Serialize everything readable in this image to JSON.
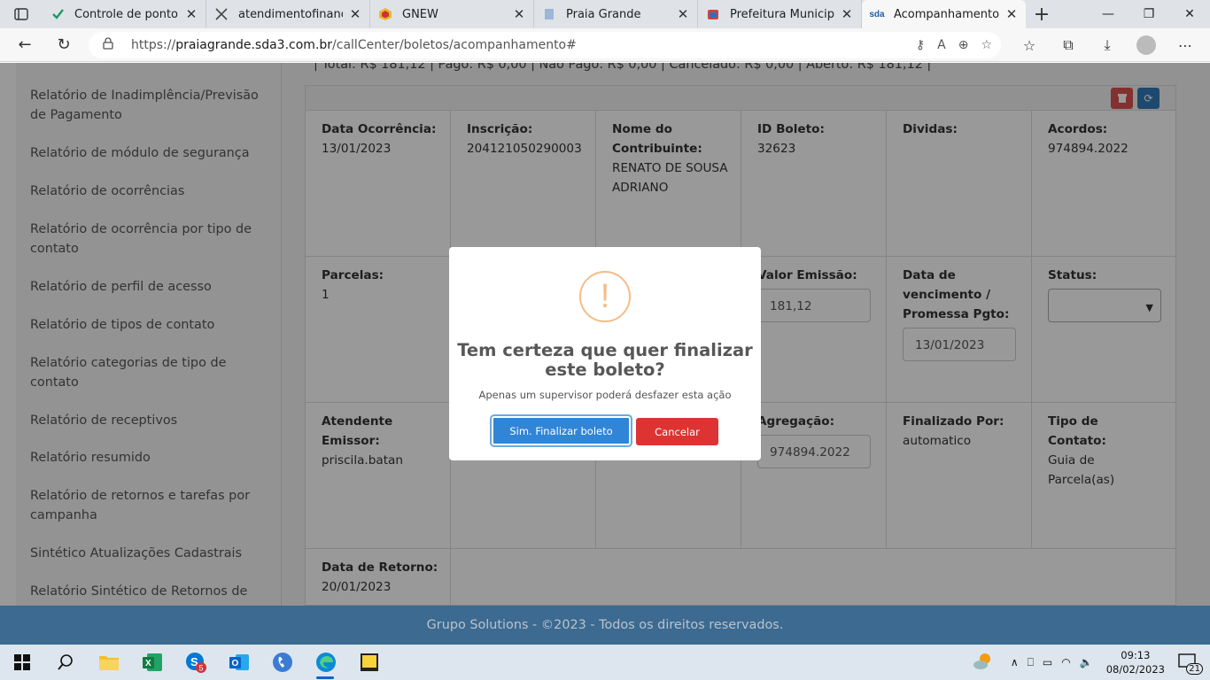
{
  "browser": {
    "tabs": [
      {
        "title": "Controle de ponto - Po",
        "icon": "check-shield-icon"
      },
      {
        "title": "atendimentofinancas@",
        "icon": "cross-arrows-icon"
      },
      {
        "title": "GNEW",
        "icon": "gnew-logo-icon"
      },
      {
        "title": "Praia Grande",
        "icon": "page-icon"
      },
      {
        "title": "Prefeitura Municipal d",
        "icon": "city-crest-icon"
      },
      {
        "title": "Acompanhamento de",
        "icon": "sda-logo-icon",
        "active": true
      }
    ],
    "url_prefix": "https://",
    "url_host": "praiagrande.sda3.com.br",
    "url_path": "/callCenter/boletos/acompanhamento#"
  },
  "sidebar": {
    "items": [
      "Relatório de Inadimplência/Previsão de Pagamento",
      "Relatório de módulo de segurança",
      "Relatório de ocorrências",
      "Relatório de ocorrência por tipo de contato",
      "Relatório de perfil de acesso",
      "Relatório de tipos de contato",
      "Relatório categorias de tipo de contato",
      "Relatório de receptivos",
      "Relatório resumido",
      "Relatório de retornos e tarefas por campanha",
      "Sintético Atualizações Cadastrais",
      "Relatório Sintético de Retornos de"
    ]
  },
  "summary": "| Total: R$ 181,12 | Pago: R$ 0,00 | Não Pago: R$ 0,00 | Cancelado: R$ 0,00 | Aberto: R$ 181,12 |",
  "boleto": {
    "data_ocorrencia": {
      "label": "Data Ocorrência:",
      "value": "13/01/2023"
    },
    "inscricao": {
      "label": "Inscrição:",
      "value": "204121050290003"
    },
    "nome": {
      "label": "Nome do Contribuinte:",
      "value": "RENATO DE SOUSA ADRIANO"
    },
    "id_boleto": {
      "label": "ID Boleto:",
      "value": "32623"
    },
    "dividas": {
      "label": "Dividas:",
      "value": ""
    },
    "acordos": {
      "label": "Acordos:",
      "value": "974894.2022"
    },
    "parcelas": {
      "label": "Parcelas:",
      "value": "1"
    },
    "valor_emissao": {
      "label": "Valor Emissão:",
      "value": "181,12"
    },
    "data_vencimento": {
      "label": "Data de vencimento / Promessa Pgto:",
      "value": "13/01/2023"
    },
    "status": {
      "label": "Status:",
      "value": ""
    },
    "atendente": {
      "label": "Atendente Emissor:",
      "value": "priscila.batan"
    },
    "agregacao": {
      "label": "Agregação:",
      "value": "974894.2022"
    },
    "finalizado": {
      "label": "Finalizado Por:",
      "value": "automatico"
    },
    "tipo_contato": {
      "label": "Tipo de Contato:",
      "value": "Guia de Parcela(as)"
    },
    "data_retorno": {
      "label": "Data de Retorno:",
      "value": "20/01/2023"
    }
  },
  "modal": {
    "icon": "!",
    "title": "Tem certeza que quer finalizar este boleto?",
    "text": "Apenas um supervisor poderá desfazer esta ação",
    "confirm_label": "Sim. Finalizar boleto",
    "cancel_label": "Cancelar"
  },
  "footer": "Grupo Solutions - ©2023 - Todos os direitos reservados.",
  "taskbar": {
    "time": "09:13",
    "date": "08/02/2023",
    "notifications": "21",
    "skype_badge": "5"
  },
  "colors": {
    "confirm": "#3085d6",
    "cancel": "#dd3333",
    "warning": "#f8bb86",
    "footer": "#3c6a90"
  }
}
